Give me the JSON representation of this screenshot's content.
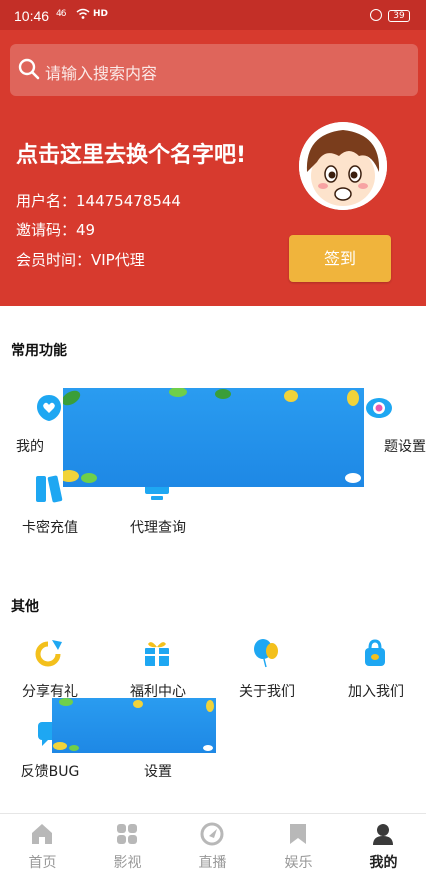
{
  "status_bar": {
    "time": "10:46",
    "signal": "46",
    "network": "HD",
    "battery": "39"
  },
  "search": {
    "placeholder": "请输入搜索内容"
  },
  "profile": {
    "name_prompt": "点击这里去换个名字吧!",
    "username": "用户名：14475478544",
    "invite_code": "邀请码：49",
    "membership": "会员时间：VIP代理",
    "signin_label": "签到"
  },
  "common_functions": {
    "title": "常用功能",
    "items": [
      {
        "label": "我的收藏",
        "visible_label": "我的",
        "icon": "heart-bubble-icon",
        "color": "#1ea7f2"
      },
      {
        "label": "主题设置",
        "visible_label": "题设置",
        "icon": "theme-eye-icon",
        "color": "#1ea7f2"
      },
      {
        "label": "卡密充值",
        "icon": "card-icon",
        "color": "#1ea7f2"
      },
      {
        "label": "代理查询",
        "icon": "monitor-icon",
        "color": "#1ea7f2"
      }
    ]
  },
  "others": {
    "title": "其他",
    "items": [
      {
        "label": "分享有礼",
        "icon": "share-icon",
        "color": "#f3c01c"
      },
      {
        "label": "福利中心",
        "icon": "gift-icon",
        "color": "#1ea7f2"
      },
      {
        "label": "关于我们",
        "icon": "balloon-icon",
        "color": "#1ea7f2"
      },
      {
        "label": "加入我们",
        "icon": "bag-icon",
        "color": "#1ea7f2"
      },
      {
        "label": "反馈BUG",
        "icon": "feedback-icon",
        "color": "#1ea7f2"
      },
      {
        "label": "设置",
        "icon": "settings-icon",
        "color": "#1ea7f2"
      }
    ]
  },
  "bottom_nav": {
    "items": [
      {
        "label": "首页",
        "icon": "home-icon",
        "active": false
      },
      {
        "label": "影视",
        "icon": "grid-icon",
        "active": false
      },
      {
        "label": "直播",
        "icon": "live-icon",
        "active": false
      },
      {
        "label": "娱乐",
        "icon": "bookmark-icon",
        "active": false
      },
      {
        "label": "我的",
        "icon": "user-icon",
        "active": true
      }
    ]
  },
  "colors": {
    "header_red": "#d73a2e",
    "status_red": "#c32f27",
    "signin_orange": "#f0b43c",
    "accent_blue": "#1ea7f2"
  }
}
